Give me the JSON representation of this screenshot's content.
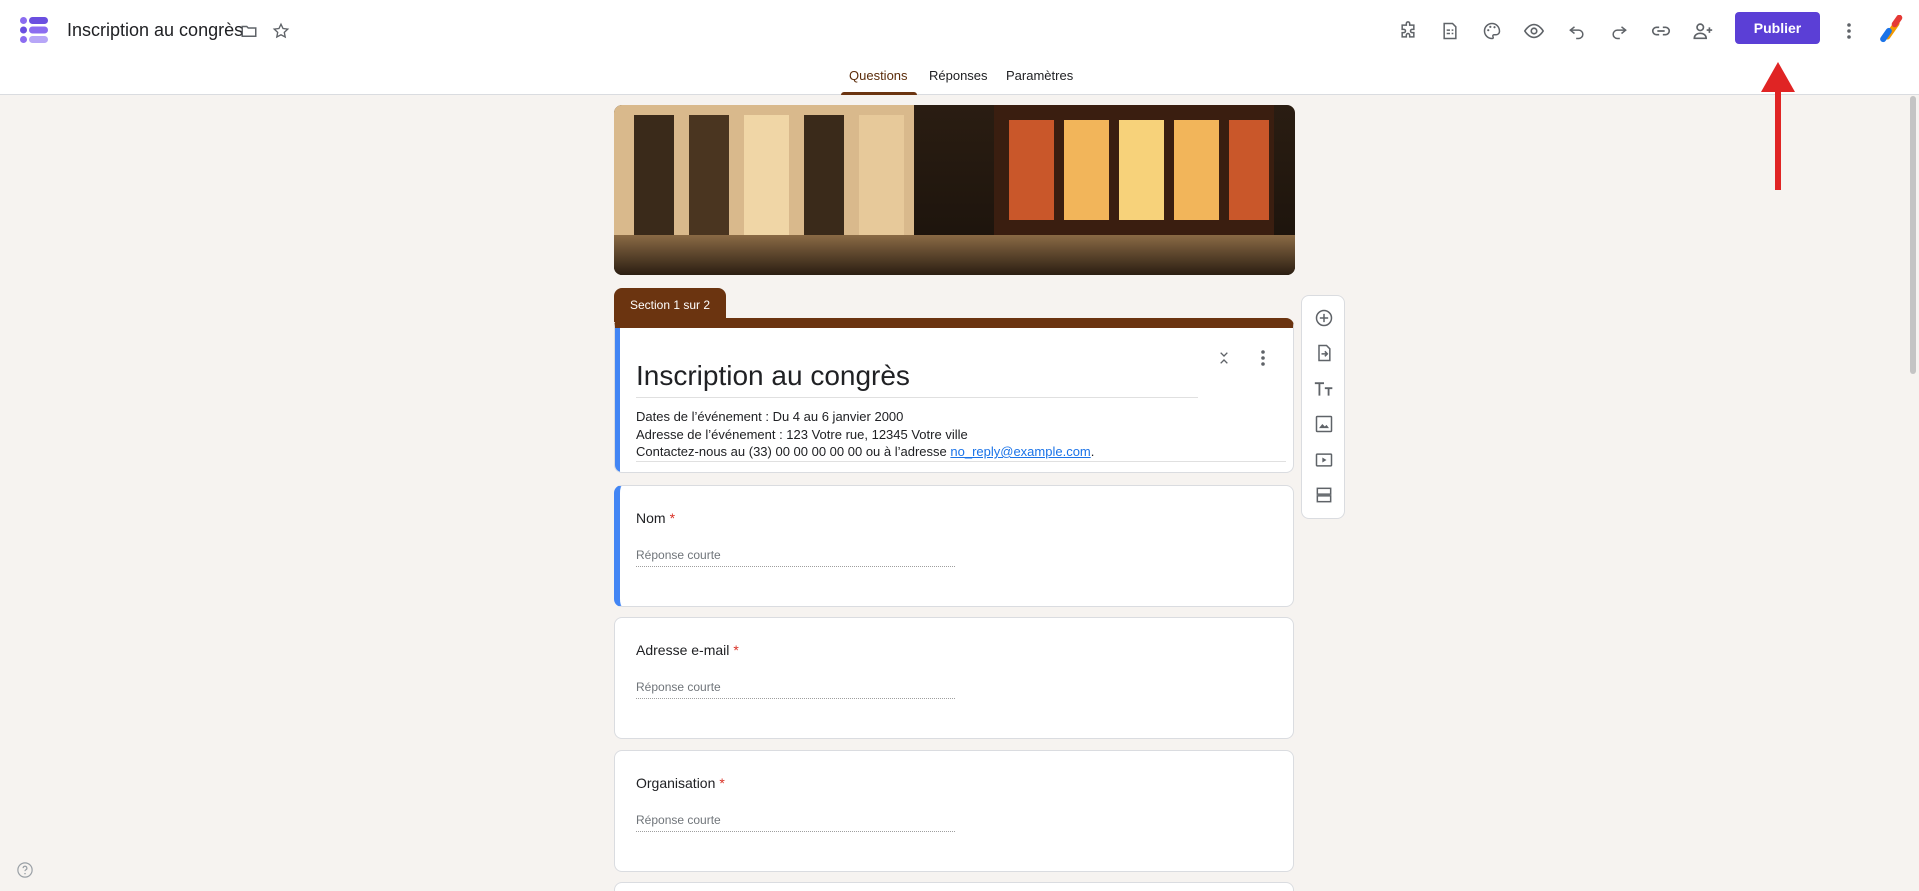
{
  "header": {
    "doc_title": "Inscription au congrès",
    "publish_label": "Publier",
    "toolbar_icons": [
      "addon-icon",
      "form-responses-icon",
      "palette-icon",
      "preview-icon",
      "undo-icon",
      "redo-icon",
      "link-icon",
      "add-collaborator-icon"
    ]
  },
  "tabs": [
    {
      "label": "Questions",
      "active": true
    },
    {
      "label": "Réponses",
      "active": false
    },
    {
      "label": "Paramètres",
      "active": false
    }
  ],
  "section_tab": "Section 1 sur 2",
  "form": {
    "title": "Inscription au congrès",
    "description_line1": "Dates de l’événement : Du 4 au 6 janvier 2000",
    "description_line2": "Adresse de l’événement : 123 Votre rue, 12345 Votre ville",
    "description_line3_prefix": "Contactez-nous au (33) 00 00 00 00 00 ou à l’adresse ",
    "email_link": "no_reply@example.com",
    "description_line3_suffix": "."
  },
  "questions": [
    {
      "label": "Nom",
      "required_mark": "*",
      "placeholder": "Réponse courte"
    },
    {
      "label": "Adresse e-mail",
      "required_mark": "*",
      "placeholder": "Réponse courte"
    },
    {
      "label": "Organisation",
      "required_mark": "*",
      "placeholder": "Réponse courte"
    }
  ],
  "side_toolbar": [
    "add-question-icon",
    "import-questions-icon",
    "add-title-icon",
    "add-image-icon",
    "add-video-icon",
    "add-section-icon"
  ],
  "colors": {
    "accent": "#5b3fd6",
    "theme": "#6b3410",
    "focus": "#4285f4",
    "background": "#f6f3f0",
    "annotation_arrow": "#e02424"
  }
}
